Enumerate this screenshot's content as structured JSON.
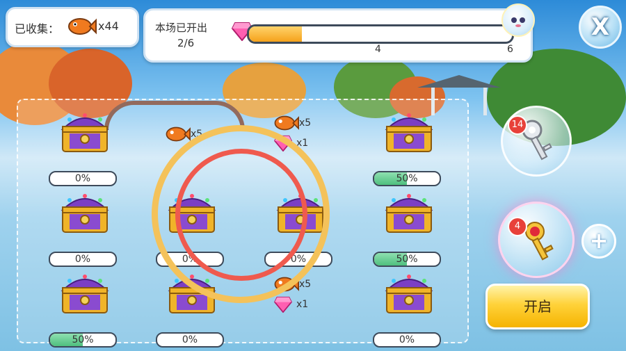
{
  "header": {
    "collected_label": "已收集：",
    "collected_count": "x44",
    "progress_title": "本场已开出",
    "progress_value": "2/6",
    "progress_fraction": 0.2,
    "tick_mid": "4",
    "tick_end": "6"
  },
  "chests": [
    {
      "progress": "0%",
      "fill": 0
    },
    {
      "progress": "",
      "fill": 0,
      "reward_fish": "x5"
    },
    {
      "progress": "",
      "fill": 0,
      "reward_fish": "x5",
      "reward_gem": "x1"
    },
    {
      "progress": "50%",
      "fill": 0.5
    },
    {
      "progress": "0%",
      "fill": 0
    },
    {
      "progress": "0%",
      "fill": 0
    },
    {
      "progress": "0%",
      "fill": 0
    },
    {
      "progress": "50%",
      "fill": 0.5
    },
    {
      "progress": "50%",
      "fill": 0.5
    },
    {
      "progress": "0%",
      "fill": 0
    },
    {
      "progress": "",
      "fill": 0,
      "reward_fish": "x5",
      "reward_gem": "x1"
    },
    {
      "progress": "0%",
      "fill": 0
    }
  ],
  "keys": {
    "silver_count": "14",
    "red_count": "4"
  },
  "buttons": {
    "close": "X",
    "plus": "+",
    "open": "开启"
  },
  "colors": {
    "accent": "#f5a21b",
    "progress_green": "#4fbf7e",
    "chest_purple": "#7b3fc4",
    "chest_gold": "#f0b429",
    "highlight_red": "#ef5a4e"
  }
}
